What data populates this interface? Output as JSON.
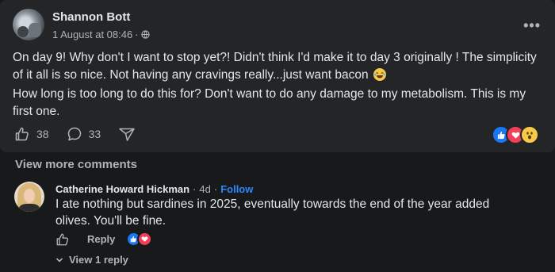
{
  "post": {
    "author": "Shannon Bott",
    "date": "1 August at 08:46",
    "meta_sep": "·",
    "paragraph1": "On day 9! Why don't I want to stop yet?! Didn't think I'd make it to day 3 originally ! The simplicity of it all is so nice. Not having any cravings really...just want bacon",
    "paragraph2": "How long is too long to do this for? Don't want to do any damage to my metabolism. This is my first one.",
    "like_count": "38",
    "comment_count": "33",
    "reactions": [
      "like-icon",
      "love-icon",
      "wow-icon"
    ],
    "more_label": "•••"
  },
  "comments": {
    "view_more_label": "View more comments",
    "items": [
      {
        "author": "Catherine Howard Hickman",
        "sep": "·",
        "time": "4d",
        "follow_label": "Follow",
        "text": "I ate nothing but sardines in 2025, eventually towards the end of the year added olives. You'll be fine.",
        "reply_label": "Reply",
        "reactions": [
          "like-icon",
          "love-icon"
        ],
        "view_replies_label": "View 1 reply"
      }
    ]
  },
  "colors": {
    "background": "#18191a",
    "card": "#242526",
    "text_primary": "#e4e6eb",
    "text_secondary": "#b0b3b8",
    "link": "#2d88ff",
    "like_blue": "#1877f2",
    "love_red": "#f33e58",
    "wow_yellow": "#f7c94b"
  }
}
